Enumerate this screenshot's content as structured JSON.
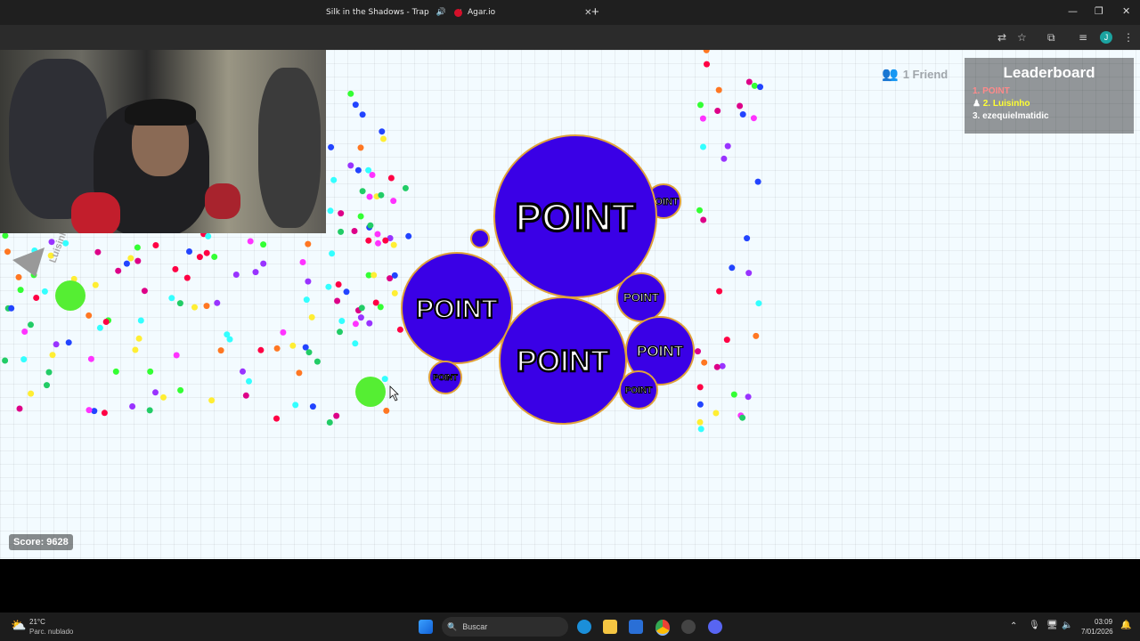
{
  "browser": {
    "tabs": [
      {
        "title": "Silk in the Shadows - Trap"
      },
      {
        "title": "Agar.io"
      }
    ],
    "new_tab": "+",
    "profile_initial": "J"
  },
  "game": {
    "score": "Score: 9628",
    "friends": "1 Friend",
    "leaderboard": {
      "title": "Leaderboard",
      "entries": [
        "1. POINT",
        "2. Luisinho",
        "3. ezequielmatidic"
      ],
      "colors": [
        "#ff8a8a",
        "#ffff33",
        "#ffffff"
      ]
    },
    "cell_name": "POINT",
    "cell_color": "#3a00e6",
    "cell_border": "#e0a23a",
    "other_player": "Luisinho"
  },
  "taskbar": {
    "weather_temp": "21°C",
    "weather_desc": "Parc. nublado",
    "search_placeholder": "Buscar",
    "time": "03:09",
    "date": "7/01/2026"
  }
}
